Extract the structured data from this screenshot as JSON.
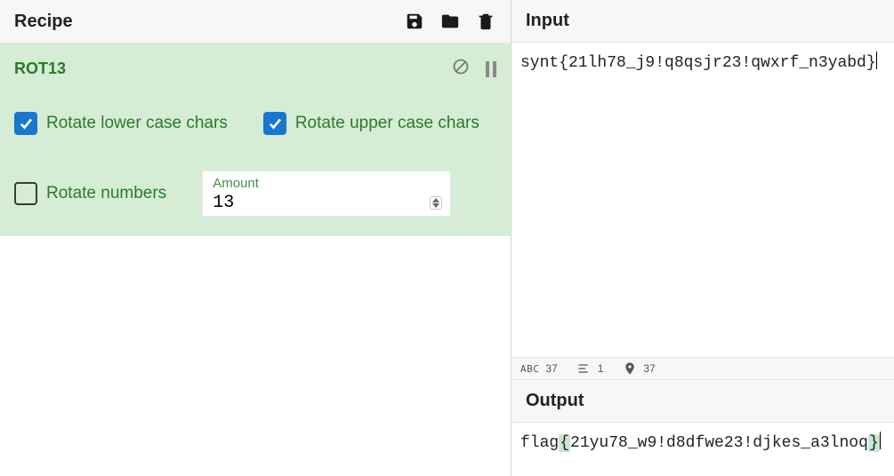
{
  "recipe": {
    "title": "Recipe",
    "toolbar": {
      "save": "save",
      "load": "load",
      "clear": "clear"
    }
  },
  "operation": {
    "name": "ROT13",
    "disable_label": "Disable operation",
    "pause_label": "Set breakpoint",
    "options": {
      "rotate_lower": {
        "label": "Rotate lower case chars",
        "checked": true
      },
      "rotate_upper": {
        "label": "Rotate upper case chars",
        "checked": true
      },
      "rotate_numbers": {
        "label": "Rotate numbers",
        "checked": false
      },
      "amount": {
        "label": "Amount",
        "value": "13"
      }
    }
  },
  "input": {
    "title": "Input",
    "value": "synt{21lh78_j9!q8qsjr23!qwxrf_n3yabd}"
  },
  "status": {
    "chars_label": "ABC",
    "chars": "37",
    "lines": "1",
    "length": "37"
  },
  "output": {
    "title": "Output",
    "value_pre": "flag",
    "brace_open": "{",
    "value_mid": "21yu78_w9!d8dfwe23!djkes_a3lnoq",
    "brace_close": "}"
  }
}
